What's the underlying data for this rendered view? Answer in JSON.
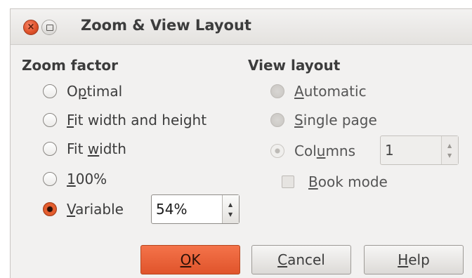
{
  "dialog": {
    "title": "Zoom & View Layout"
  },
  "zoom_factor": {
    "heading": "Zoom factor",
    "options": [
      {
        "pre": "O",
        "key": "p",
        "post": "timal",
        "checked": false
      },
      {
        "pre": "",
        "key": "F",
        "post": "it width and height",
        "checked": false
      },
      {
        "pre": "Fit ",
        "key": "w",
        "post": "idth",
        "checked": false
      },
      {
        "pre": "",
        "key": "1",
        "post": "00%",
        "checked": false
      },
      {
        "pre": "",
        "key": "V",
        "post": "ariable",
        "checked": true
      }
    ],
    "variable_value": "54%"
  },
  "view_layout": {
    "heading": "View layout",
    "options": [
      {
        "pre": "",
        "key": "A",
        "post": "utomatic",
        "enabled": false
      },
      {
        "pre": "",
        "key": "S",
        "post": "ingle page",
        "enabled": false
      },
      {
        "pre": "Col",
        "key": "u",
        "post": "mns",
        "enabled": false,
        "selected": true
      }
    ],
    "columns_value": "1",
    "book_mode": {
      "pre": "",
      "key": "B",
      "post": "ook mode",
      "checked": false,
      "enabled": false
    }
  },
  "buttons": {
    "ok": {
      "pre": "",
      "key": "O",
      "post": "K"
    },
    "cancel": {
      "pre": "",
      "key": "C",
      "post": "ancel"
    },
    "help": {
      "pre": "",
      "key": "H",
      "post": "elp"
    }
  },
  "colors": {
    "accent": "#e0542b",
    "background": "#f2f1f0",
    "text": "#3c3c3c"
  },
  "icons": {
    "close": "close-icon",
    "maximize": "maximize-icon",
    "spin_up": "spin-up-icon",
    "spin_down": "spin-down-icon"
  }
}
